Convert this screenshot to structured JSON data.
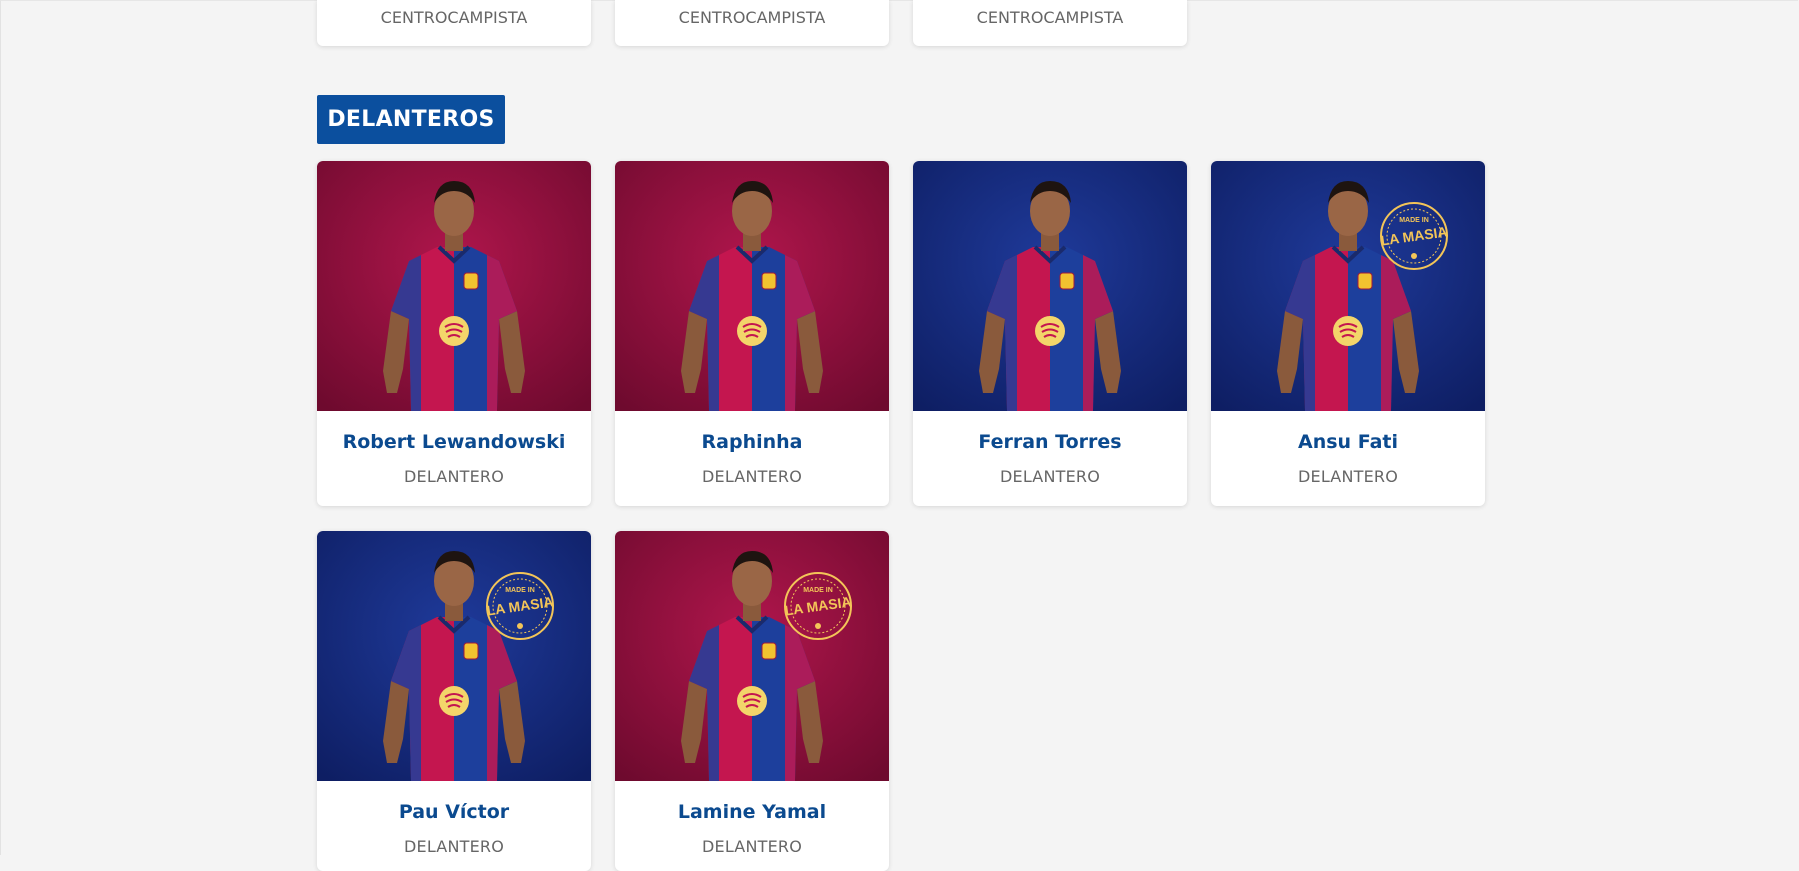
{
  "midfielders_tail": [
    {
      "position": "CENTROCAMPISTA"
    },
    {
      "position": "CENTROCAMPISTA"
    },
    {
      "position": "CENTROCAMPISTA"
    }
  ],
  "forwards": {
    "title": "DELANTEROS",
    "players": [
      {
        "name": "Robert Lewandowski",
        "position": "DELANTERO",
        "background": "#b0164c",
        "la_masia": false
      },
      {
        "name": "Raphinha",
        "position": "DELANTERO",
        "background": "#b0164c",
        "la_masia": false
      },
      {
        "name": "Ferran Torres",
        "position": "DELANTERO",
        "background": "#1f3a9a",
        "la_masia": false
      },
      {
        "name": "Ansu Fati",
        "position": "DELANTERO",
        "background": "#1f3a9a",
        "la_masia": true
      },
      {
        "name": "Pau Víctor",
        "position": "DELANTERO",
        "background": "#1f3a9a",
        "la_masia": true
      },
      {
        "name": "Lamine Yamal",
        "position": "DELANTERO",
        "background": "#b0164c",
        "la_masia": true
      }
    ]
  },
  "la_masia_badge": {
    "line1": "MADE IN",
    "line2": "LA MASIA"
  },
  "colors": {
    "accent": "#0b4f9e",
    "name_text": "#0b4a8f",
    "blaugrana_red": "#c4164f",
    "blaugrana_blue": "#1d3f9c"
  }
}
